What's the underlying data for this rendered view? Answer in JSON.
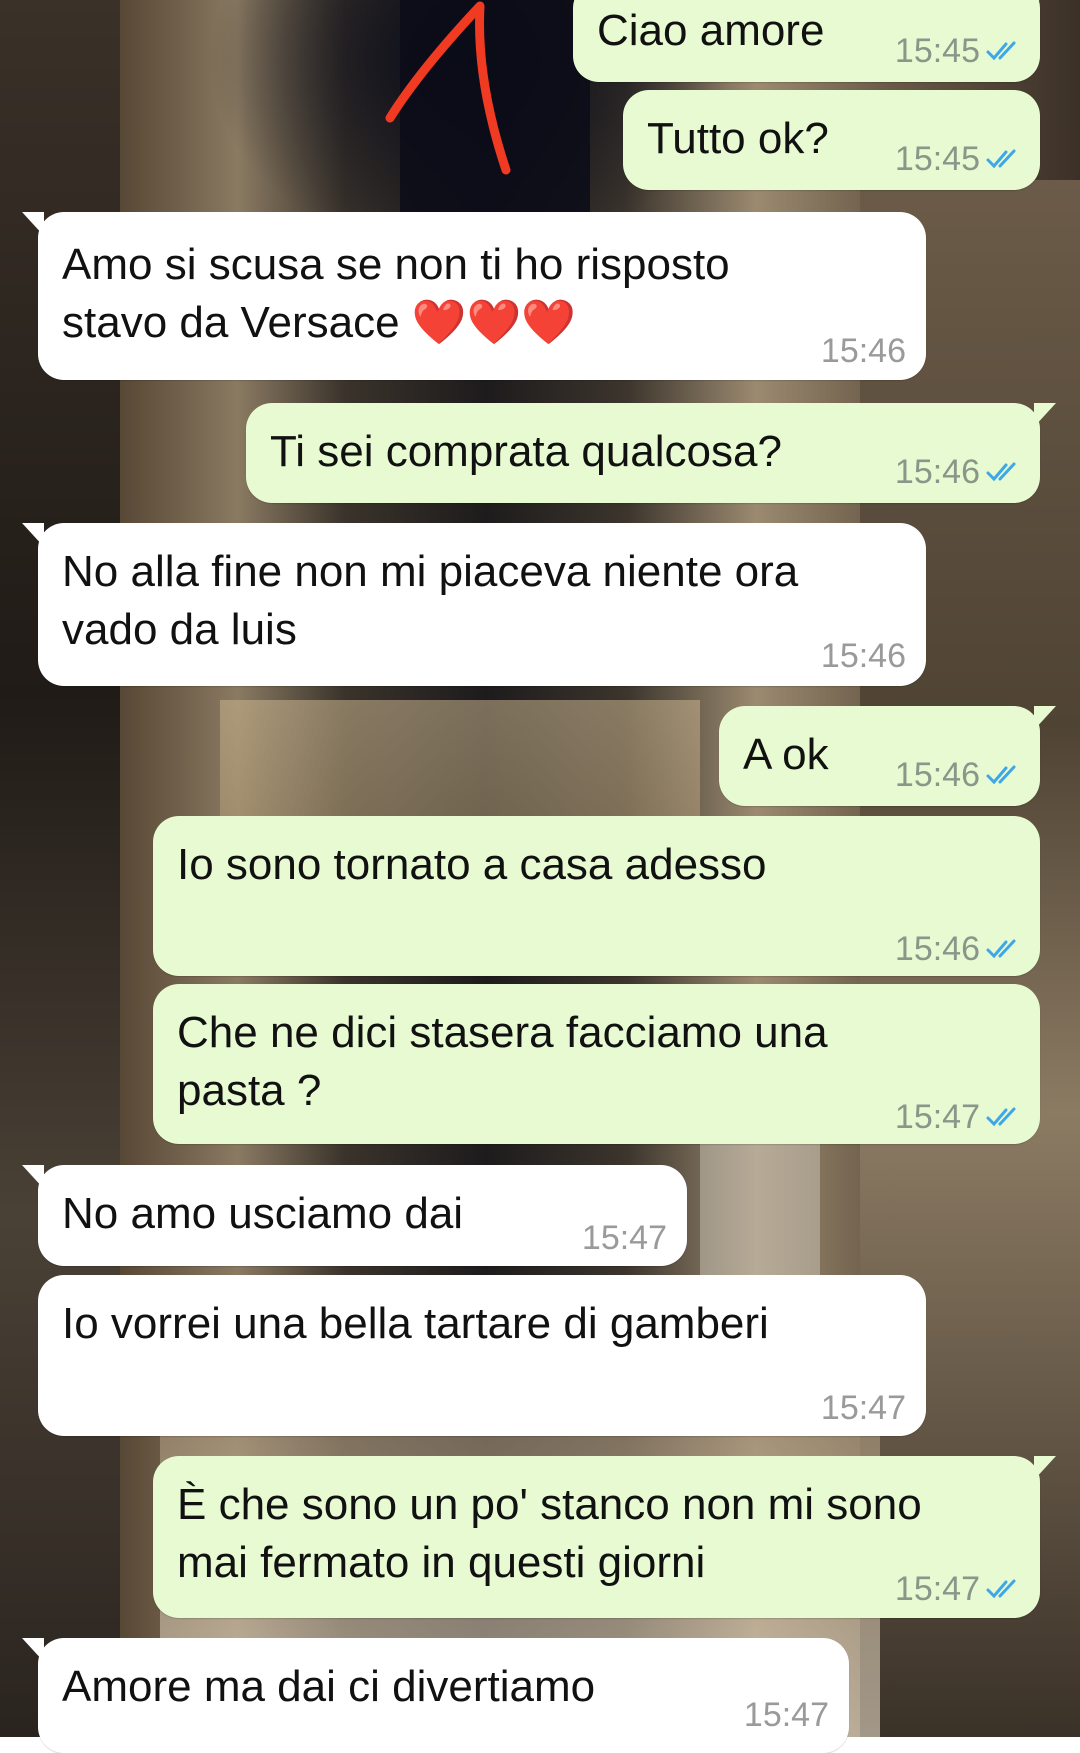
{
  "colors": {
    "outgoing_bubble": "#e7fad1",
    "incoming_bubble": "#ffffff",
    "read_ticks": "#3fa7e8",
    "annotation_arrow": "#f03a22"
  },
  "icons": {
    "read_receipt": "double-check-icon",
    "annotation": "red-arrow-annotation"
  },
  "messages": [
    {
      "direction": "outgoing",
      "text": "Ciao amore",
      "time": "15:45",
      "status": "read"
    },
    {
      "direction": "outgoing",
      "text": "Tutto ok?",
      "time": "15:45",
      "status": "read"
    },
    {
      "direction": "incoming",
      "text": "Amo si scusa se non ti ho risposto\nstavo da Versace ❤️❤️❤️",
      "time": "15:46"
    },
    {
      "direction": "outgoing",
      "text": "Ti sei comprata qualcosa?",
      "time": "15:46",
      "status": "read"
    },
    {
      "direction": "incoming",
      "text": "No alla fine non mi piaceva niente ora\nvado da luis",
      "time": "15:46"
    },
    {
      "direction": "outgoing",
      "text": "A ok",
      "time": "15:46",
      "status": "read"
    },
    {
      "direction": "outgoing",
      "text": "Io sono tornato a casa adesso",
      "time": "15:46",
      "status": "read"
    },
    {
      "direction": "outgoing",
      "text": "Che ne dici stasera facciamo una\npasta ?",
      "time": "15:47",
      "status": "read"
    },
    {
      "direction": "incoming",
      "text": "No amo usciamo dai",
      "time": "15:47"
    },
    {
      "direction": "incoming",
      "text": "Io vorrei una bella tartare di gamberi",
      "time": "15:47"
    },
    {
      "direction": "outgoing",
      "text": "È che sono un po' stanco non mi sono\nmai fermato in questi giorni",
      "time": "15:47",
      "status": "read"
    },
    {
      "direction": "incoming",
      "text": "Amore ma dai ci divertiamo",
      "time": "15:47"
    }
  ]
}
